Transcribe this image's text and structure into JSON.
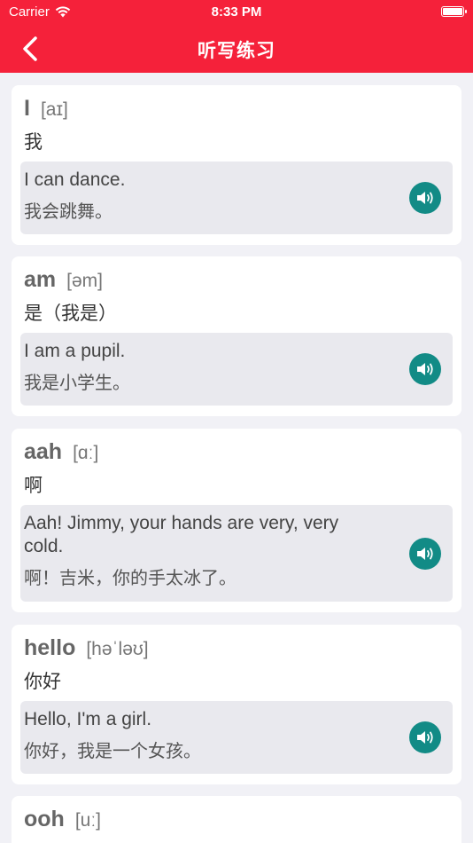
{
  "status": {
    "carrier": "Carrier",
    "time": "8:33 PM"
  },
  "nav": {
    "title": "听写练习",
    "back_icon": "chevron-left-icon"
  },
  "colors": {
    "accent": "#f5213a",
    "speaker": "#128b86",
    "background": "#f1f1f6"
  },
  "words": [
    {
      "word": "I",
      "phonetic": "[aɪ]",
      "meaning": "我",
      "example_en": "I can dance.",
      "example_zh": "我会跳舞。"
    },
    {
      "word": "am",
      "phonetic": "[əm]",
      "meaning": "是（我是）",
      "example_en": "I am a pupil.",
      "example_zh": "我是小学生。"
    },
    {
      "word": "aah",
      "phonetic": "[ɑː]",
      "meaning": "啊",
      "example_en": "Aah! Jimmy, your hands are very, very cold.",
      "example_zh": "啊！吉米，你的手太冰了。"
    },
    {
      "word": "hello",
      "phonetic": "[həˈləʊ]",
      "meaning": "你好",
      "example_en": "Hello, I'm a girl.",
      "example_zh": "你好，我是一个女孩。"
    },
    {
      "word": "ooh",
      "phonetic": "[uː]"
    }
  ]
}
